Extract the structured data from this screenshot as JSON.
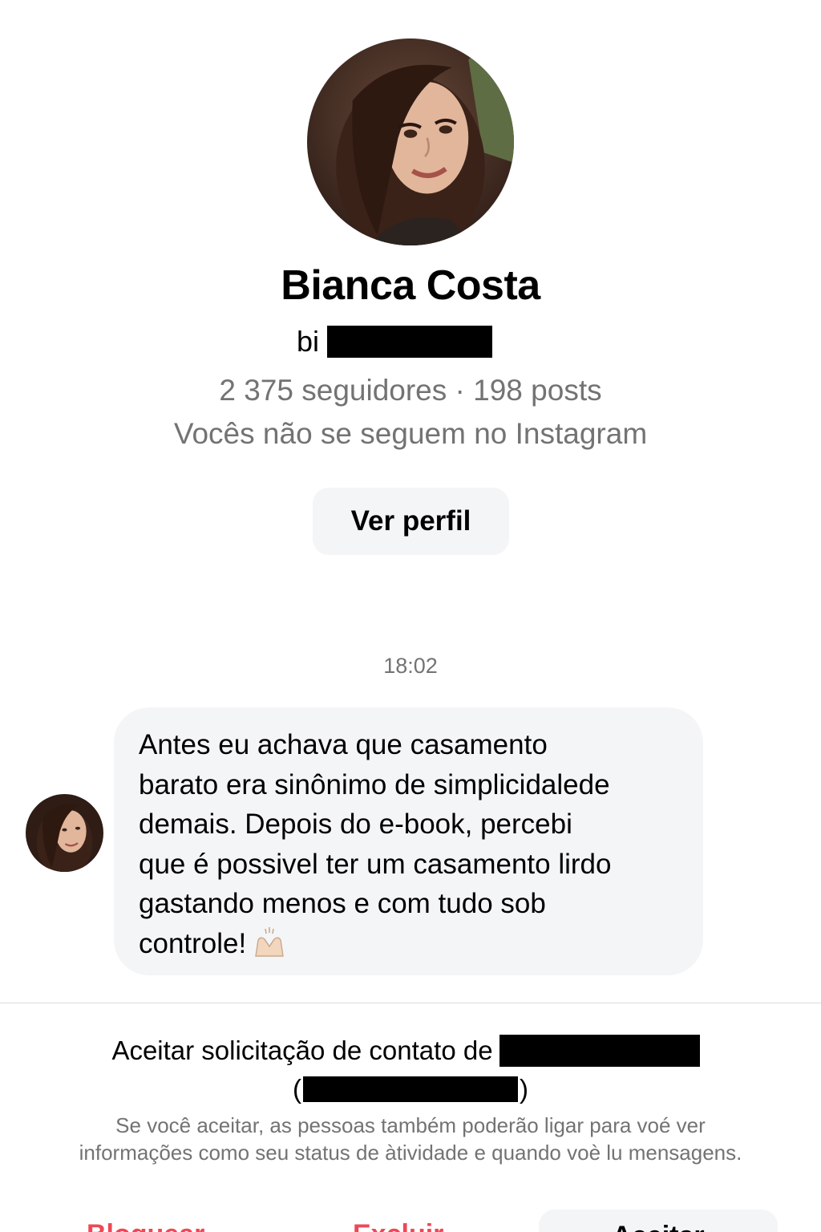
{
  "profile": {
    "name": "Bianca Costa",
    "handle_prefix": "bi",
    "followers": "2 375 seguidores",
    "separator": "·",
    "posts": "198 posts",
    "mutual_text": "Vocês não se seguem no Instagram",
    "view_profile_label": "Ver perfil"
  },
  "conversation": {
    "timestamp": "18:02",
    "message_lines": [
      "Antes eu achava que casamento",
      "barato era sinônimo de simplicidalede",
      "demais. Depois do e-book, percebi",
      "que é possivel ter um casamento lirdo",
      "gastando menos e com tudo sob",
      "controle!"
    ],
    "emoji_icon": "handshake-icon"
  },
  "request": {
    "title": "Aceitar solicitação de contato de",
    "open_paren": "(",
    "close_paren": ")",
    "disclaimer": "Se você aceitar, as pessoas também poderão ligar para voé ver informações como seu status de àtividade e quando voè lu mensagens."
  },
  "actions": {
    "block_label": "Bloquear",
    "delete_label": "Excluir",
    "accept_label": "Aceitar",
    "danger_color": "#ed4956"
  },
  "colors": {
    "secondary_text": "#737373",
    "bubble_bg": "#f4f5f7",
    "divider": "#dbdbdb"
  }
}
